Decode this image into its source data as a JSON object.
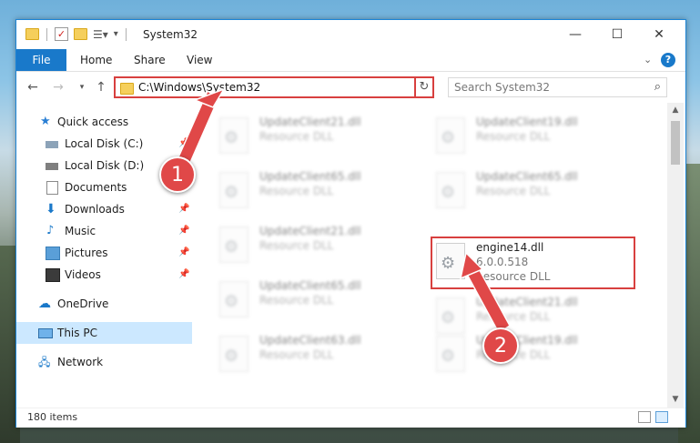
{
  "window": {
    "title": "System32",
    "controls": {
      "minimize": "—",
      "maximize": "☐",
      "close": "✕"
    }
  },
  "ribbon": {
    "tabs": [
      "File",
      "Home",
      "Share",
      "View"
    ],
    "expand_icon": "chevron-down-icon",
    "help_label": "?"
  },
  "address": {
    "path": "C:\\Windows\\System32",
    "dropdown_glyph": "⌄",
    "refresh_glyph": "↻"
  },
  "search": {
    "placeholder": "Search System32"
  },
  "sidebar": {
    "quick_access": "Quick access",
    "items": [
      {
        "label": "Local Disk (C:)",
        "icon": "drive-icon",
        "pinned": true
      },
      {
        "label": "Local Disk (D:)",
        "icon": "drive-icon",
        "pinned": false
      },
      {
        "label": "Documents",
        "icon": "documents-icon",
        "pinned": true
      },
      {
        "label": "Downloads",
        "icon": "downloads-icon",
        "pinned": true
      },
      {
        "label": "Music",
        "icon": "music-icon",
        "pinned": true
      },
      {
        "label": "Pictures",
        "icon": "pictures-icon",
        "pinned": true
      },
      {
        "label": "Videos",
        "icon": "videos-icon",
        "pinned": true
      }
    ],
    "onedrive": "OneDrive",
    "this_pc": "This PC",
    "network": "Network"
  },
  "files": [
    {
      "name": "UpdateClient21.dll",
      "type": "Resource DLL",
      "blurred": true
    },
    {
      "name": "UpdateClient19.dll",
      "type": "Resource DLL",
      "blurred": true
    },
    {
      "name": "UpdateClient65.dll",
      "type": "Resource DLL",
      "blurred": true
    },
    {
      "name": "UpdateClient65.dll",
      "type": "Resource DLL",
      "blurred": true
    },
    {
      "name": "UpdateClient21.dll",
      "type": "Resource DLL",
      "blurred": true
    },
    {
      "name": "engine14.dll",
      "version": "6.0.0.518",
      "type": "Resource DLL",
      "blurred": false
    },
    {
      "name": "UpdateClient65.dll",
      "type": "Resource DLL",
      "blurred": true
    },
    {
      "name": "UpdateClient21.dll",
      "type": "Resource DLL",
      "blurred": true
    },
    {
      "name": "UpdateClient63.dll",
      "type": "Resource DLL",
      "blurred": true
    },
    {
      "name": "UpdateClient19.dll",
      "type": "Resource DLL",
      "blurred": true
    }
  ],
  "status": {
    "item_count": "180 items"
  },
  "callouts": {
    "one": "1",
    "two": "2"
  },
  "colors": {
    "accent": "#1979ca",
    "highlight": "#d8403f",
    "selected": "#cce8ff"
  }
}
